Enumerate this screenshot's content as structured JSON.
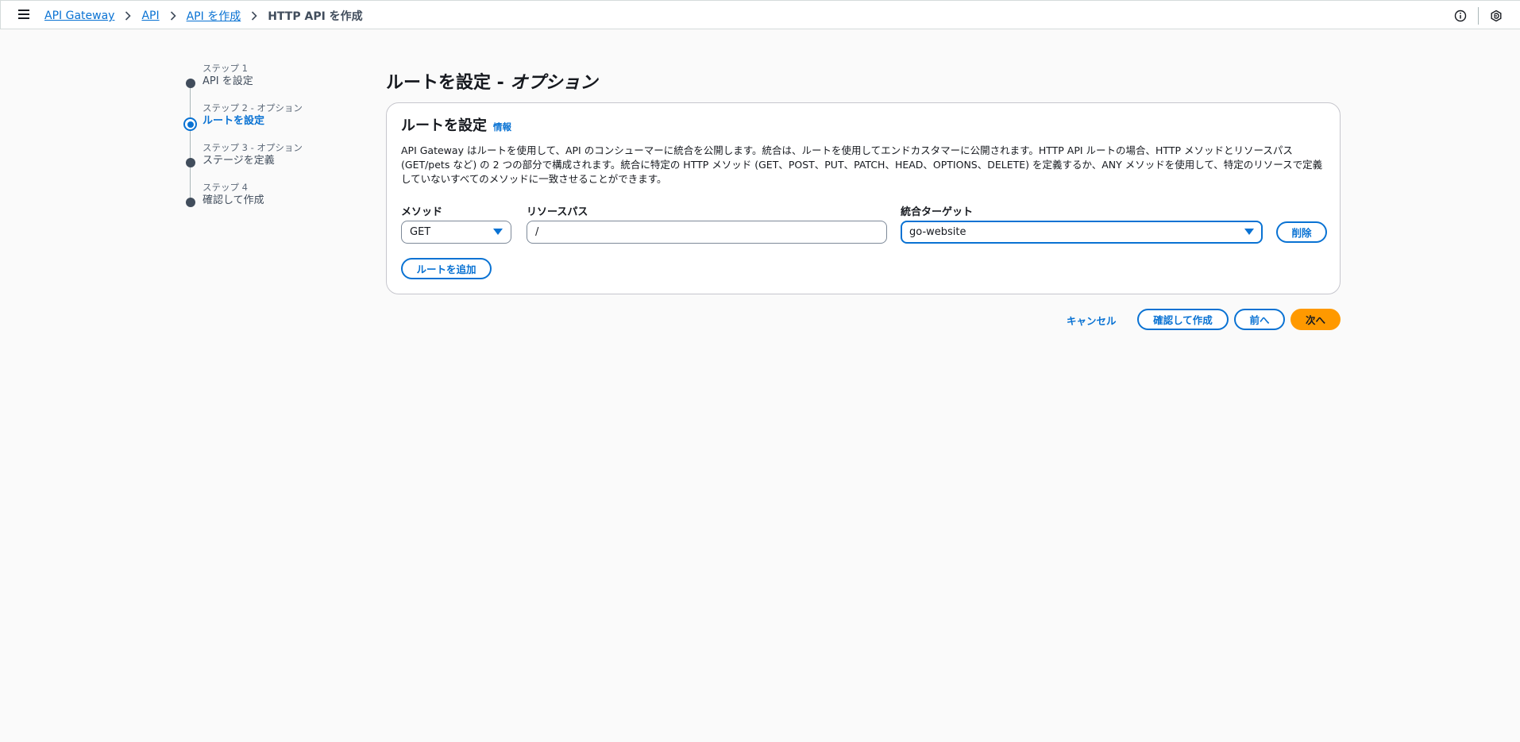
{
  "breadcrumb": {
    "items": [
      "API Gateway",
      "API",
      "API を作成"
    ],
    "current": "HTTP API を作成"
  },
  "steps": [
    {
      "num": "ステップ 1",
      "title": "API を設定"
    },
    {
      "num": "ステップ 2 - オプション",
      "title": "ルートを設定"
    },
    {
      "num": "ステップ 3 - オプション",
      "title": "ステージを定義"
    },
    {
      "num": "ステップ 4",
      "title": "確認して作成"
    }
  ],
  "page": {
    "title_main": "ルートを設定 - ",
    "title_italic": "オプション"
  },
  "panel": {
    "title": "ルートを設定",
    "info": "情報",
    "description": "API Gateway はルートを使用して、API のコンシューマーに統合を公開します。統合は、ルートを使用してエンドカスタマーに公開されます。HTTP API ルートの場合、HTTP メソッドとリソースパス (GET/pets など) の 2 つの部分で構成されます。統合に特定の HTTP メソッド (GET、POST、PUT、PATCH、HEAD、OPTIONS、DELETE) を定義するか、ANY メソッドを使用して、特定のリソースで定義していないすべてのメソッドに一致させることができます。",
    "method_label": "メソッド",
    "method_value": "GET",
    "path_label": "リソースパス",
    "path_value": "/",
    "target_label": "統合ターゲット",
    "target_value": "go-website",
    "delete_label": "削除",
    "add_route_label": "ルートを追加"
  },
  "footer": {
    "cancel": "キャンセル",
    "review_create": "確認して作成",
    "previous": "前へ",
    "next": "次へ"
  },
  "colors": {
    "accent": "#0972d3",
    "primary": "#ff9900"
  }
}
